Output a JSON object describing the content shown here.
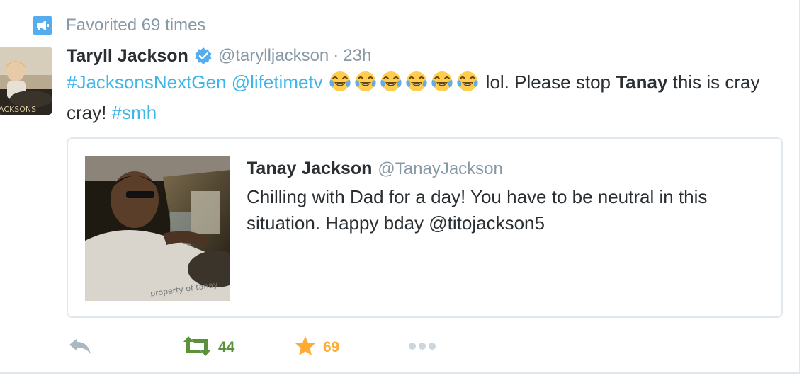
{
  "context": {
    "icon": "promoted-megaphone-icon",
    "text": "Favorited 69 times"
  },
  "tweet": {
    "fullname": "Taryll Jackson",
    "verified": true,
    "username": "@tarylljackson",
    "separator": "·",
    "time": "23h",
    "hashtag1": "#JacksonsNextGen",
    "mention1": "@lifetimetv",
    "emoji_count": 6,
    "emoji": "face-with-tears-of-joy",
    "text_part1": "lol. Please stop ",
    "bold_word": "Tanay",
    "text_part2": " this is cray cray! ",
    "hashtag2": "#smh"
  },
  "quoted": {
    "fullname": "Tanay Jackson",
    "username": "@TanayJackson",
    "text": "Chilling with Dad for a day! You have to be neutral in this situation. Happy bday @titojackson5"
  },
  "actions": {
    "reply_icon": "reply-icon",
    "retweet_icon": "retweet-icon",
    "retweet_count": "44",
    "favorite_icon": "star-icon",
    "favorite_count": "69",
    "more_icon": "more-dots-icon"
  },
  "colors": {
    "link": "#3fb5e8",
    "muted": "#8899a6",
    "retweet": "#5c913b",
    "favorite": "#ffac33",
    "verified": "#55acee"
  }
}
